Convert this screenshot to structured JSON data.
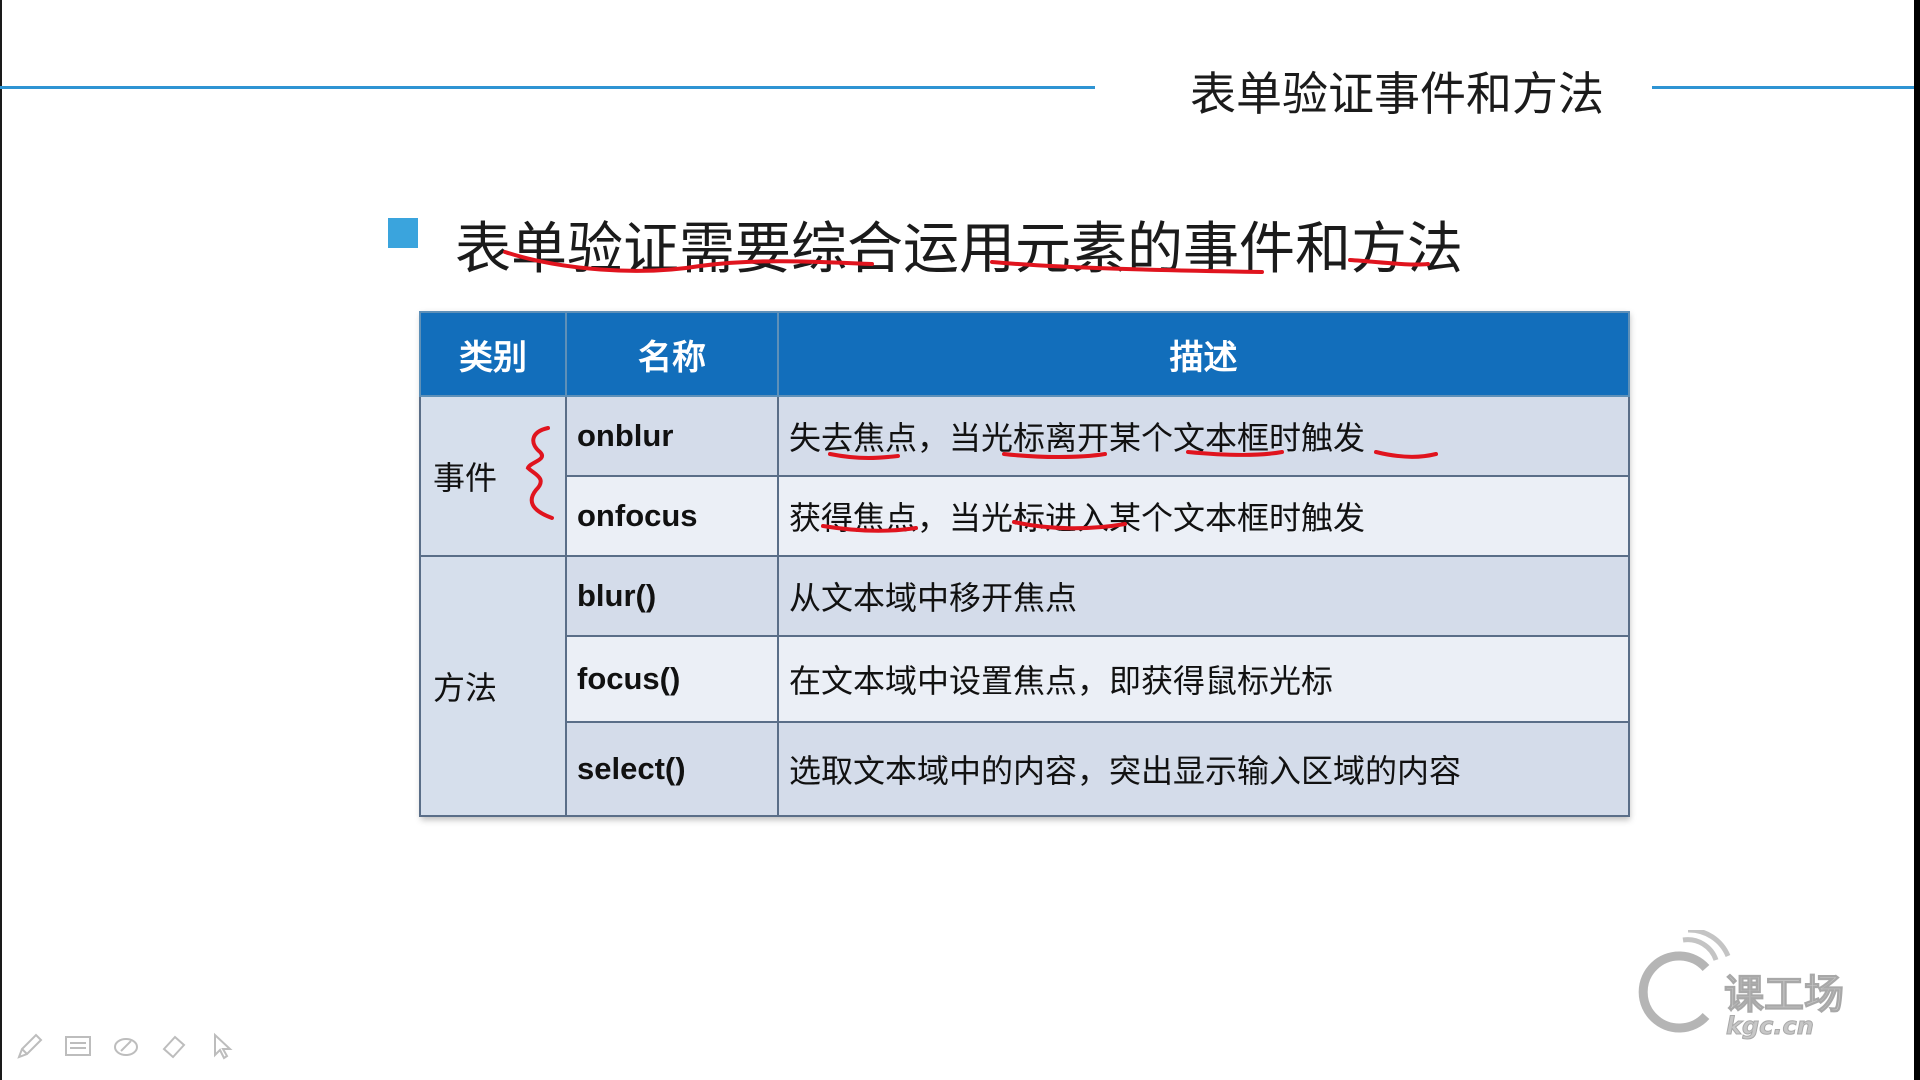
{
  "slide": {
    "title": "表单验证事件和方法",
    "bullet": "表单验证需要综合运用元素的事件和方法"
  },
  "table": {
    "headers": [
      "类别",
      "名称",
      "描述"
    ],
    "rows": [
      {
        "category": "事件",
        "name": "onblur",
        "description": "失去焦点，当光标离开某个文本框时触发"
      },
      {
        "category": "",
        "name": "onfocus",
        "description": "获得焦点，当光标进入某个文本框时触发"
      },
      {
        "category": "方法",
        "name": "blur()",
        "description": "从文本域中移开焦点"
      },
      {
        "category": "",
        "name": "focus()",
        "description": "在文本域中设置焦点，即获得鼠标光标"
      },
      {
        "category": "",
        "name": "select()",
        "description": "选取文本域中的内容，突出显示输入区域的内容"
      }
    ]
  },
  "toolbar": {
    "icons": [
      "pen-icon",
      "slides-icon",
      "highlighter-icon",
      "eraser-icon",
      "pointer-icon"
    ]
  },
  "logo": {
    "text_main": "课工场",
    "text_sub": "kgc.cn"
  },
  "colors": {
    "accent": "#2e94d3",
    "header_bg": "#126ebb",
    "annotation": "#e0141e"
  }
}
